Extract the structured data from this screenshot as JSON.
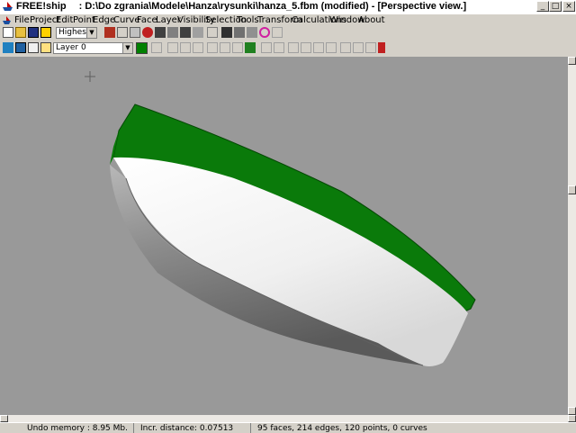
{
  "window": {
    "app_name": "FREE!ship",
    "file_title": ": D:\\Do zgrania\\Modele\\Hanza\\rysunki\\hanza_5.fbm (modified) - [Perspective view.]"
  },
  "menu": [
    "File",
    "Project",
    "Edit",
    "Point",
    "Edge",
    "Curve",
    "Face",
    "Layer",
    "Visibility",
    "Selection",
    "Tools",
    "Transform",
    "Calculations",
    "Window",
    "About"
  ],
  "toolbar": {
    "precision_value": "Highest",
    "layer_value": "Layer 0",
    "layer_color": "#008000"
  },
  "viewport": {
    "background": "#999999",
    "hull_top_color": "#0a7a0a",
    "hull_side_color": "#f2f2f2"
  },
  "status": {
    "undo_memory": "Undo memory : 8.95 Mb.",
    "incr_distance": "Incr. distance: 0.07513",
    "geometry_stats": "95 faces, 214 edges, 120 points, 0 curves"
  }
}
